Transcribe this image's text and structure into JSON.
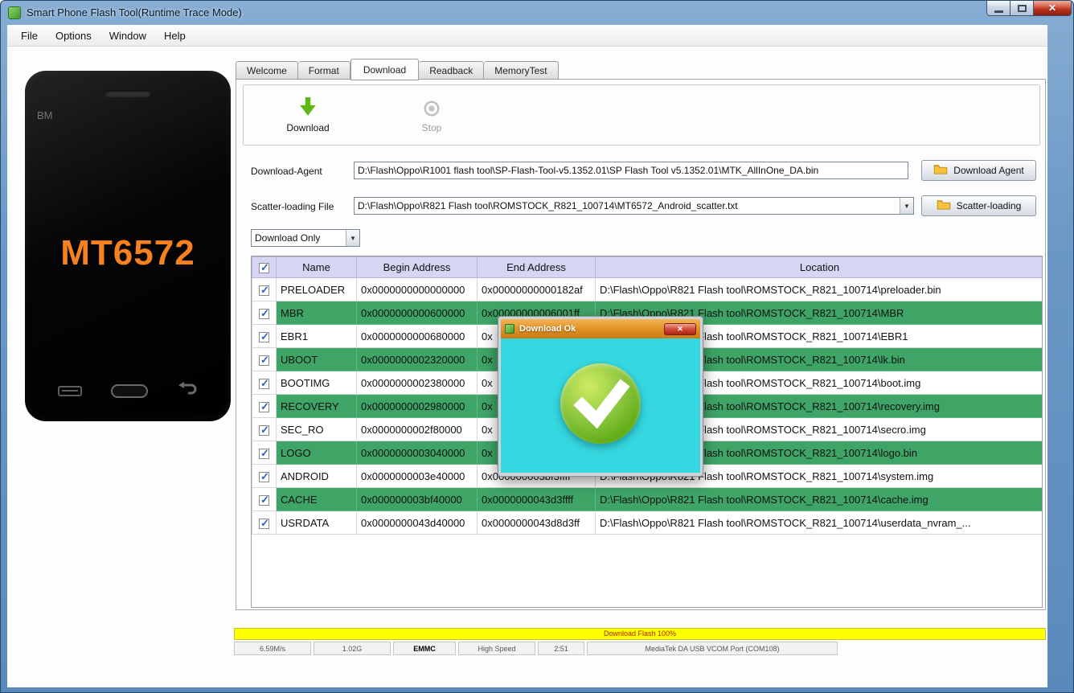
{
  "window": {
    "title": "Smart Phone Flash Tool(Runtime Trace Mode)"
  },
  "menu": {
    "items": [
      "File",
      "Options",
      "Window",
      "Help"
    ]
  },
  "phone": {
    "brand": "BM",
    "model": "MT6572",
    "model_color": "#f5821f"
  },
  "tabs": {
    "items": [
      {
        "label": "Welcome"
      },
      {
        "label": "Format"
      },
      {
        "label": "Download",
        "active": true
      },
      {
        "label": "Readback"
      },
      {
        "label": "MemoryTest"
      }
    ]
  },
  "toolbar": {
    "download_label": "Download",
    "stop_label": "Stop"
  },
  "fields": {
    "download_agent": {
      "label": "Download-Agent",
      "value": "D:\\Flash\\Oppo\\R1001 flash tool\\SP-Flash-Tool-v5.1352.01\\SP Flash Tool v5.1352.01\\MTK_AllInOne_DA.bin",
      "button": "Download Agent"
    },
    "scatter": {
      "label": "Scatter-loading File",
      "value": "D:\\Flash\\Oppo\\R821 Flash tool\\ROMSTOCK_R821_100714\\MT6572_Android_scatter.txt",
      "button": "Scatter-loading"
    },
    "mode": {
      "value": "Download Only"
    }
  },
  "table": {
    "headers": [
      "",
      "Name",
      "Begin Address",
      "End Address",
      "Location"
    ],
    "rows": [
      {
        "checked": true,
        "name": "PRELOADER",
        "begin": "0x0000000000000000",
        "end": "0x00000000000182af",
        "location": "D:\\Flash\\Oppo\\R821 Flash tool\\ROMSTOCK_R821_100714\\preloader.bin",
        "highlight": false
      },
      {
        "checked": true,
        "name": "MBR",
        "begin": "0x0000000000600000",
        "end": "0x00000000006001ff",
        "location": "D:\\Flash\\Oppo\\R821 Flash tool\\ROMSTOCK_R821_100714\\MBR",
        "highlight": true
      },
      {
        "checked": true,
        "name": "EBR1",
        "begin": "0x0000000000680000",
        "end": "0x",
        "location": "D:\\Flash\\Oppo\\R821 Flash tool\\ROMSTOCK_R821_100714\\EBR1",
        "highlight": false
      },
      {
        "checked": true,
        "name": "UBOOT",
        "begin": "0x0000000002320000",
        "end": "0x",
        "location": "D:\\Flash\\Oppo\\R821 Flash tool\\ROMSTOCK_R821_100714\\lk.bin",
        "highlight": true
      },
      {
        "checked": true,
        "name": "BOOTIMG",
        "begin": "0x0000000002380000",
        "end": "0x",
        "location": "D:\\Flash\\Oppo\\R821 Flash tool\\ROMSTOCK_R821_100714\\boot.img",
        "highlight": false
      },
      {
        "checked": true,
        "name": "RECOVERY",
        "begin": "0x0000000002980000",
        "end": "0x",
        "location": "D:\\Flash\\Oppo\\R821 Flash tool\\ROMSTOCK_R821_100714\\recovery.img",
        "highlight": true
      },
      {
        "checked": true,
        "name": "SEC_RO",
        "begin": "0x0000000002f80000",
        "end": "0x",
        "location": "D:\\Flash\\Oppo\\R821 Flash tool\\ROMSTOCK_R821_100714\\secro.img",
        "highlight": false
      },
      {
        "checked": true,
        "name": "LOGO",
        "begin": "0x0000000003040000",
        "end": "0x",
        "location": "D:\\Flash\\Oppo\\R821 Flash tool\\ROMSTOCK_R821_100714\\logo.bin",
        "highlight": true
      },
      {
        "checked": true,
        "name": "ANDROID",
        "begin": "0x0000000003e40000",
        "end": "0x000000003bf3ffff",
        "location": "D:\\Flash\\Oppo\\R821 Flash tool\\ROMSTOCK_R821_100714\\system.img",
        "highlight": false
      },
      {
        "checked": true,
        "name": "CACHE",
        "begin": "0x000000003bf40000",
        "end": "0x0000000043d3ffff",
        "location": "D:\\Flash\\Oppo\\R821 Flash tool\\ROMSTOCK_R821_100714\\cache.img",
        "highlight": true
      },
      {
        "checked": true,
        "name": "USRDATA",
        "begin": "0x0000000043d40000",
        "end": "0x0000000043d8d3ff",
        "location": "D:\\Flash\\Oppo\\R821 Flash tool\\ROMSTOCK_R821_100714\\userdata_nvram_...",
        "highlight": false
      }
    ]
  },
  "dialog": {
    "title": "Download Ok"
  },
  "status": {
    "progress_text": "Download Flash 100%",
    "cells": [
      "6.59M/s",
      "1.02G",
      "EMMC",
      "High Speed",
      "2:51",
      "MediaTek DA USB VCOM Port (COM108)"
    ]
  },
  "icons": {
    "dropdown": "▼",
    "close": "✕",
    "check": "✓"
  }
}
